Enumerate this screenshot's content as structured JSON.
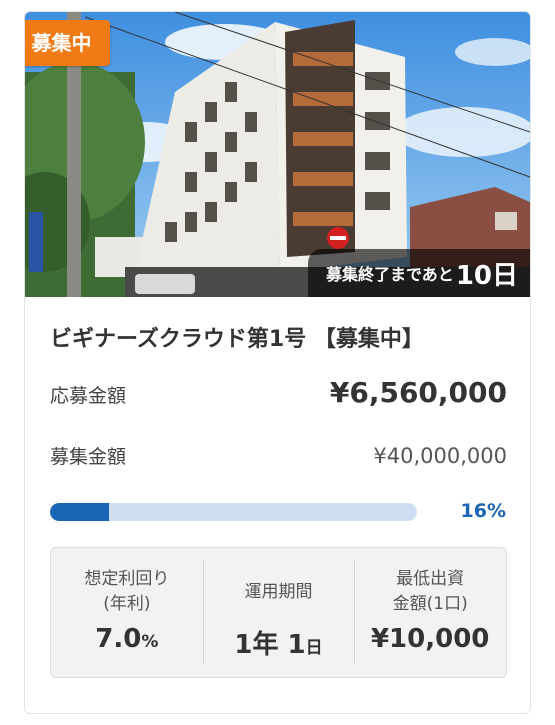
{
  "badge": "募集中",
  "countdown": {
    "prefix": "募集終了まであと",
    "days": "10日"
  },
  "title": "ビギナーズクラウド第1号 【募集中】",
  "applied": {
    "label": "応募金額",
    "value": "¥6,560,000"
  },
  "target": {
    "label": "募集金額",
    "value": "¥40,000,000"
  },
  "progress": {
    "percent": 16,
    "text": "16%"
  },
  "stats": [
    {
      "label": "想定利回り\n(年利)",
      "value_main": "7.0",
      "value_unit": "%"
    },
    {
      "label": "運用期間",
      "value_main": "1年 1",
      "value_unit": "日"
    },
    {
      "label": "最低出資\n金額(1口)",
      "value_main": "¥10,000",
      "value_unit": ""
    }
  ],
  "colors": {
    "badge": "#f07a14",
    "accent": "#1a65b5",
    "track": "#cddff0"
  }
}
